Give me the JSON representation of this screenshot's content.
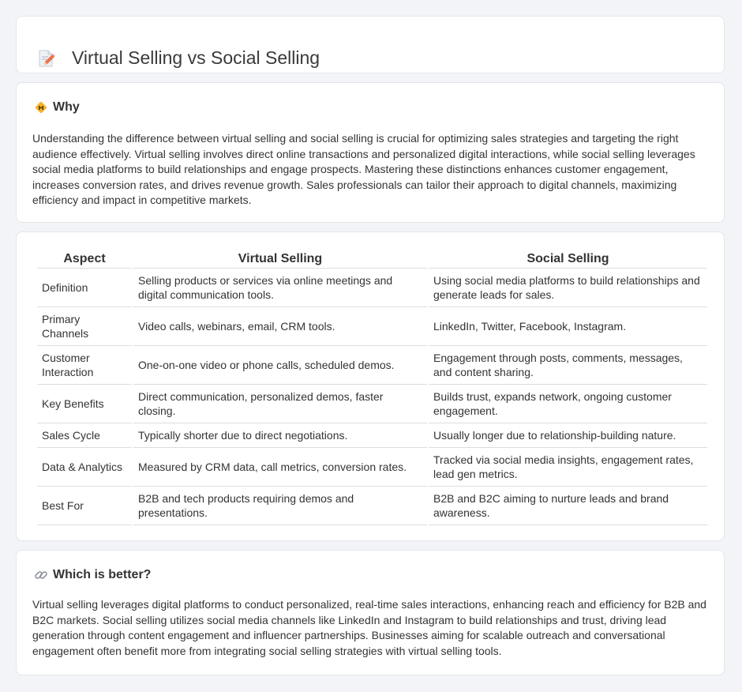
{
  "header": {
    "title": "Virtual Selling vs Social Selling",
    "icon": "document-pencil-icon"
  },
  "why": {
    "title": "Why",
    "icon": "diamond-sign-icon",
    "text": "Understanding the difference between virtual selling and social selling is crucial for optimizing sales strategies and targeting the right audience effectively. Virtual selling involves direct online transactions and personalized digital interactions, while social selling leverages social media platforms to build relationships and engage prospects. Mastering these distinctions enhances customer engagement, increases conversion rates, and drives revenue growth. Sales professionals can tailor their approach to digital channels, maximizing efficiency and impact in competitive markets."
  },
  "table": {
    "headers": [
      "Aspect",
      "Virtual Selling",
      "Social Selling"
    ],
    "rows": [
      {
        "aspect": "Definition",
        "virtual": "Selling products or services via online meetings and digital communication tools.",
        "social": "Using social media platforms to build relationships and generate leads for sales."
      },
      {
        "aspect": "Primary Channels",
        "virtual": "Video calls, webinars, email, CRM tools.",
        "social": "LinkedIn, Twitter, Facebook, Instagram."
      },
      {
        "aspect": "Customer Interaction",
        "virtual": "One-on-one video or phone calls, scheduled demos.",
        "social": "Engagement through posts, comments, messages, and content sharing."
      },
      {
        "aspect": "Key Benefits",
        "virtual": "Direct communication, personalized demos, faster closing.",
        "social": "Builds trust, expands network, ongoing customer engagement."
      },
      {
        "aspect": "Sales Cycle",
        "virtual": "Typically shorter due to direct negotiations.",
        "social": "Usually longer due to relationship-building nature."
      },
      {
        "aspect": "Data & Analytics",
        "virtual": "Measured by CRM data, call metrics, conversion rates.",
        "social": "Tracked via social media insights, engagement rates, lead gen metrics."
      },
      {
        "aspect": "Best For",
        "virtual": "B2B and tech products requiring demos and presentations.",
        "social": "B2B and B2C aiming to nurture leads and brand awareness."
      }
    ]
  },
  "better": {
    "title": "Which is better?",
    "icon": "link-icon",
    "text": "Virtual selling leverages digital platforms to conduct personalized, real-time sales interactions, enhancing reach and efficiency for B2B and B2C markets. Social selling utilizes social media channels like LinkedIn and Instagram to build relationships and trust, driving lead generation through content engagement and influencer partnerships. Businesses aiming for scalable outreach and conversational engagement often benefit more from integrating social selling strategies with virtual selling tools."
  }
}
